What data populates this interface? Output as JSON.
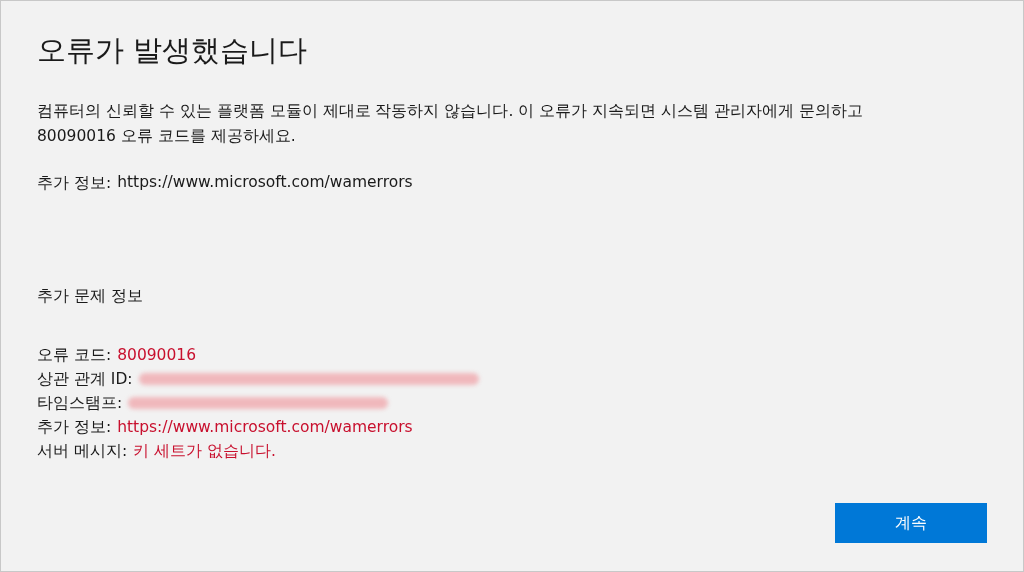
{
  "title": "오류가 발생했습니다",
  "message": "컴퓨터의 신뢰할 수 있는 플랫폼 모듈이 제대로 작동하지 않습니다. 이 오류가 지속되면 시스템 관리자에게 문의하고 80090016 오류 코드를 제공하세요.",
  "more_info": {
    "label": "추가 정보:",
    "url": "https://www.microsoft.com/wamerrors"
  },
  "details": {
    "heading": "추가 문제 정보",
    "rows": [
      {
        "kind": "text",
        "label": "오류 코드:",
        "value": "80090016"
      },
      {
        "kind": "redacted",
        "label": "상관 관계 ID:"
      },
      {
        "kind": "redacted",
        "label": "타임스탬프:"
      },
      {
        "kind": "link",
        "label": "추가 정보:",
        "value": "https://www.microsoft.com/wamerrors"
      },
      {
        "kind": "text",
        "label": "서버 메시지:",
        "value": "키 세트가 없습니다."
      }
    ]
  },
  "button": "계속"
}
